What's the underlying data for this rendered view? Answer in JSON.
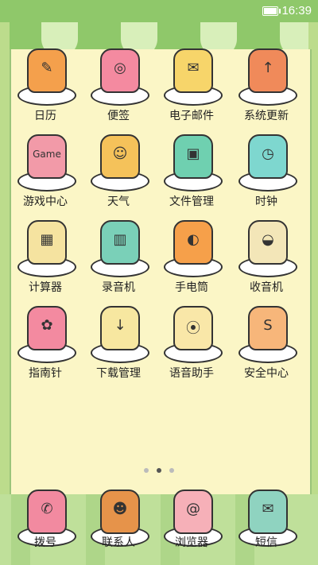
{
  "status": {
    "time": "16:39"
  },
  "apps": [
    {
      "label": "日历",
      "icon": "calendar-cake-icon",
      "color": "#f4a04c",
      "glyph": "✎"
    },
    {
      "label": "便签",
      "icon": "notes-cake-icon",
      "color": "#f48aa0",
      "glyph": "◎"
    },
    {
      "label": "电子邮件",
      "icon": "email-cake-icon",
      "color": "#f7d56a",
      "glyph": "✉"
    },
    {
      "label": "系统更新",
      "icon": "system-update-icon",
      "color": "#f08a5a",
      "glyph": "↑"
    },
    {
      "label": "游戏中心",
      "icon": "game-center-icon",
      "color": "#f29aa8",
      "glyph": "Game"
    },
    {
      "label": "天气",
      "icon": "weather-cupcake-icon",
      "color": "#f5c25a",
      "glyph": "☺"
    },
    {
      "label": "文件管理",
      "icon": "file-manager-icon",
      "color": "#6fd0b0",
      "glyph": "▣"
    },
    {
      "label": "时钟",
      "icon": "clock-teapot-icon",
      "color": "#7ed7cf",
      "glyph": "◷"
    },
    {
      "label": "计算器",
      "icon": "calculator-icon",
      "color": "#f5e3a0",
      "glyph": "▦"
    },
    {
      "label": "录音机",
      "icon": "recorder-icon",
      "color": "#7ad0b8",
      "glyph": "▥"
    },
    {
      "label": "手电筒",
      "icon": "flashlight-jelly-icon",
      "color": "#f6a04a",
      "glyph": "◐"
    },
    {
      "label": "收音机",
      "icon": "radio-cake-icon",
      "color": "#f3e6b8",
      "glyph": "◒"
    },
    {
      "label": "指南针",
      "icon": "compass-cake-icon",
      "color": "#f38aa0",
      "glyph": "✿"
    },
    {
      "label": "下载管理",
      "icon": "download-manager-icon",
      "color": "#f7e7a0",
      "glyph": "↓"
    },
    {
      "label": "语音助手",
      "icon": "voice-assistant-icon",
      "color": "#f9e7a8",
      "glyph": "⦿"
    },
    {
      "label": "安全中心",
      "icon": "security-center-icon",
      "color": "#f7b67a",
      "glyph": "S"
    }
  ],
  "pages": {
    "count": 3,
    "active": 2
  },
  "dock": [
    {
      "label": "拨号",
      "icon": "dialer-cake-icon",
      "color": "#f28aa0",
      "glyph": "✆"
    },
    {
      "label": "联系人",
      "icon": "contacts-gingerbread-icon",
      "color": "#e6934a",
      "glyph": "☻"
    },
    {
      "label": "浏览器",
      "icon": "browser-roll-icon",
      "color": "#f6b0b8",
      "glyph": "@"
    },
    {
      "label": "短信",
      "icon": "messages-cake-icon",
      "color": "#8fd3c0",
      "glyph": "✉"
    }
  ],
  "colors": {
    "awning_green": "#8fc86a",
    "awning_light": "#d8efba",
    "wall": "#fbf6c6"
  }
}
